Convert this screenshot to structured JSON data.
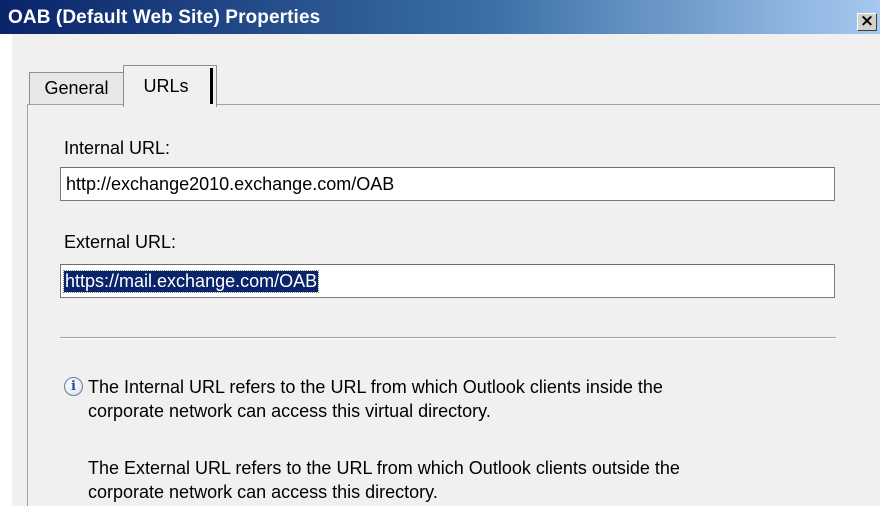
{
  "window": {
    "title": "OAB (Default Web Site) Properties",
    "close_glyph": "×"
  },
  "tabs": [
    {
      "label": "General",
      "selected": false
    },
    {
      "label": "URLs",
      "selected": true
    }
  ],
  "form": {
    "internal_url_label": "Internal URL:",
    "internal_url_value": "http://exchange2010.exchange.com/OAB",
    "external_url_label": "External URL:",
    "external_url_value_first_char": "h",
    "external_url_value_rest": "ttps://mail.exchange.com/OAB",
    "external_url_value": "https://mail.exchange.com/OAB"
  },
  "info": {
    "icon": "info-icon",
    "para1_line1": "The Internal URL refers to the URL from which Outlook clients inside the",
    "para1_line2": "corporate network can access this virtual directory.",
    "para2_line1": "The External URL refers to the URL from which Outlook clients outside the",
    "para2_line2": "corporate network can access this directory."
  },
  "colors": {
    "titlebar_start": "#0a246a",
    "titlebar_end": "#a6caf0",
    "selection": "#0a246a",
    "panel_bg": "#f0f0f0"
  }
}
